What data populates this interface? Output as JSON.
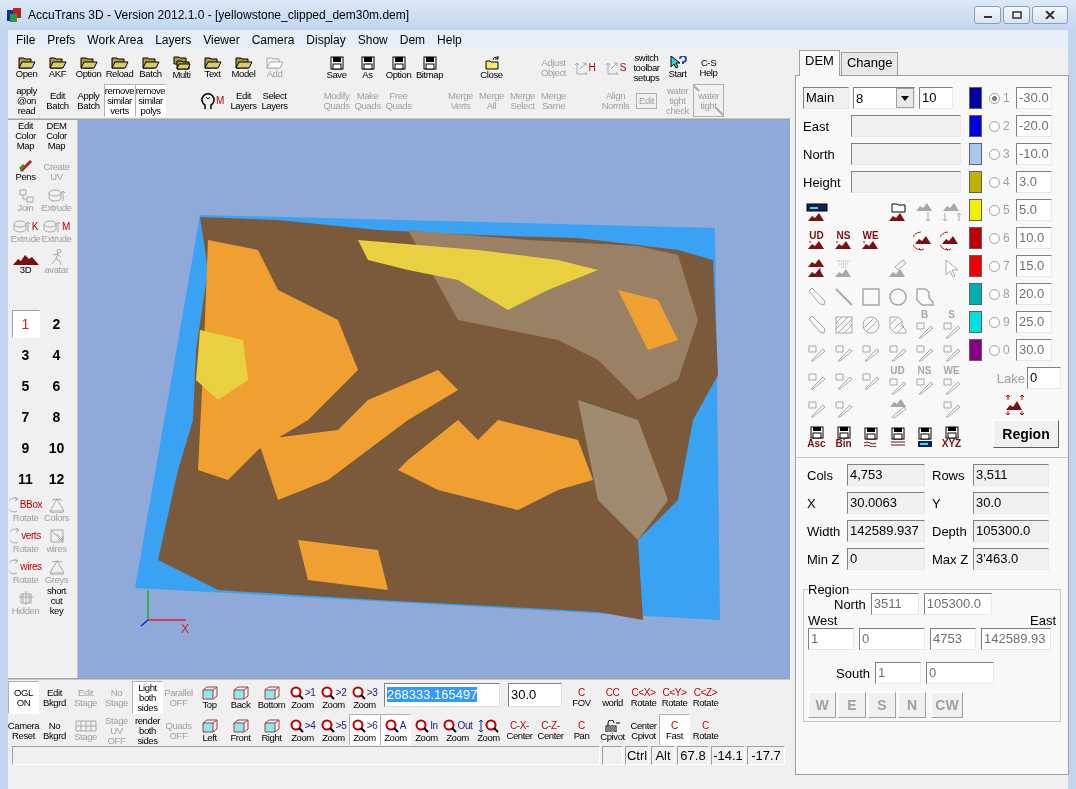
{
  "window": {
    "title": "AccuTrans 3D - Version 2012.1.0 - [yellowstone_clipped_dem30m.dem]"
  },
  "menu": [
    "File",
    "Prefs",
    "Work Area",
    "Layers",
    "Viewer",
    "Camera",
    "Display",
    "Show",
    "Dem",
    "Help"
  ],
  "top_toolbar": {
    "rows": [
      {
        "items": [
          {
            "kind": "folder",
            "lines": [
              "Open"
            ],
            "disabled": false
          },
          {
            "kind": "folder",
            "lines": [
              "AKF"
            ],
            "disabled": false
          },
          {
            "kind": "folder",
            "lines": [
              "Option"
            ],
            "disabled": false
          },
          {
            "kind": "folder",
            "lines": [
              "Reload"
            ],
            "disabled": false
          },
          {
            "kind": "folder",
            "lines": [
              "Batch"
            ],
            "disabled": false
          },
          {
            "kind": "folders",
            "lines": [
              "Multi"
            ],
            "disabled": false
          },
          {
            "kind": "folder",
            "lines": [
              "Text"
            ],
            "disabled": false
          },
          {
            "kind": "folder",
            "lines": [
              "Model"
            ],
            "disabled": false
          },
          {
            "kind": "folder",
            "lines": [
              "Add"
            ],
            "disabled": true
          },
          {
            "kind": "floppy",
            "lines": [
              "Save"
            ],
            "disabled": false
          },
          {
            "kind": "floppy",
            "lines": [
              "As"
            ],
            "disabled": false
          },
          {
            "kind": "floppy",
            "lines": [
              "Option"
            ],
            "disabled": false
          },
          {
            "kind": "floppy",
            "lines": [
              "Bitmap"
            ],
            "disabled": false
          },
          {
            "kind": "folder-up",
            "lines": [
              "Close"
            ],
            "disabled": false
          },
          {
            "kind": "text",
            "lines": [
              "Adjust",
              "Object"
            ],
            "disabled": true
          },
          {
            "kind": "axes",
            "tag": "H",
            "disabled": true
          },
          {
            "kind": "axes",
            "tag": "S",
            "disabled": true
          },
          {
            "kind": "text",
            "lines": [
              "switch",
              "toolbar",
              "setups"
            ],
            "disabled": false
          },
          {
            "kind": "pointer",
            "lines": [
              "Start"
            ],
            "disabled": false
          },
          {
            "kind": "text",
            "lines": [
              "C-S",
              "Help"
            ],
            "disabled": false
          }
        ]
      },
      {
        "items": [
          {
            "kind": "text",
            "lines": [
              "apply",
              "@on",
              "read"
            ],
            "disabled": false,
            "on": false
          },
          {
            "kind": "text",
            "lines": [
              "Edit",
              "Batch"
            ],
            "disabled": false,
            "on": false
          },
          {
            "kind": "text",
            "lines": [
              "Apply",
              "Batch"
            ],
            "disabled": false,
            "on": false
          },
          {
            "kind": "text",
            "lines": [
              "remove",
              "similar",
              "verts"
            ],
            "disabled": false,
            "on": true
          },
          {
            "kind": "text",
            "lines": [
              "remove",
              "similar",
              "polys"
            ],
            "disabled": false,
            "on": true
          },
          {
            "kind": "head",
            "tag": "M",
            "disabled": false,
            "on": false
          },
          {
            "kind": "text",
            "lines": [
              "Edit",
              "Layers"
            ],
            "disabled": false,
            "on": false
          },
          {
            "kind": "text",
            "lines": [
              "Select",
              "Layers"
            ],
            "disabled": false,
            "on": false
          },
          {
            "kind": "text",
            "lines": [
              "Modify",
              "Quads"
            ],
            "disabled": true,
            "on": false
          },
          {
            "kind": "text",
            "lines": [
              "Make",
              "Quads"
            ],
            "disabled": true,
            "on": false
          },
          {
            "kind": "text",
            "lines": [
              "Free",
              "Quads"
            ],
            "disabled": true,
            "on": false
          },
          {
            "kind": "text",
            "lines": [
              "Merge",
              "Verts"
            ],
            "disabled": true,
            "on": false
          },
          {
            "kind": "text",
            "lines": [
              "Merge",
              "All"
            ],
            "disabled": true,
            "on": false
          },
          {
            "kind": "text",
            "lines": [
              "Merge",
              "Select"
            ],
            "disabled": true,
            "on": false
          },
          {
            "kind": "text",
            "lines": [
              "Merge",
              "Same"
            ],
            "disabled": true,
            "on": false
          },
          {
            "kind": "text",
            "lines": [
              "Align",
              "Normls"
            ],
            "disabled": true,
            "on": false
          },
          {
            "kind": "frame",
            "lines": [
              "Edit"
            ],
            "disabled": true,
            "on": false
          },
          {
            "kind": "text",
            "lines": [
              "water",
              "tight",
              "check"
            ],
            "disabled": true,
            "on": false
          },
          {
            "kind": "crossed",
            "lines": [
              "water",
              "tight"
            ],
            "disabled": true,
            "on": false
          }
        ]
      }
    ]
  },
  "left_toolbar": {
    "top": [
      {
        "kind": "text",
        "lines": [
          "Edit",
          "Color",
          "Map"
        ],
        "disabled": false
      },
      {
        "kind": "pens",
        "lines": [
          "Pens"
        ],
        "disabled": false
      },
      {
        "kind": "join",
        "lines": [
          "Join"
        ],
        "disabled": true
      },
      {
        "kind": "extrude",
        "tag": "K",
        "lines": [
          "Extrude"
        ],
        "disabled": true
      },
      {
        "kind": "mountain",
        "lines": [
          "3D"
        ],
        "disabled": false
      },
      {
        "kind": "text",
        "lines": [
          "DEM",
          "Color",
          "Map"
        ],
        "disabled": false
      },
      {
        "kind": "text",
        "lines": [
          "Create",
          "UV"
        ],
        "disabled": true
      },
      {
        "kind": "extrude",
        "lines": [
          "Extrude"
        ],
        "disabled": true
      },
      {
        "kind": "extrude",
        "tag": "M",
        "lines": [
          "Extrude"
        ],
        "disabled": true
      },
      {
        "kind": "figure",
        "lines": [
          "avatar"
        ],
        "disabled": true
      }
    ],
    "numbers": [
      {
        "label": "1",
        "selected": true
      },
      {
        "label": "2",
        "selected": false
      },
      {
        "label": "3",
        "selected": false
      },
      {
        "label": "4",
        "selected": false
      },
      {
        "label": "5",
        "selected": false
      },
      {
        "label": "6",
        "selected": false
      },
      {
        "label": "7",
        "selected": false
      },
      {
        "label": "8",
        "selected": false
      },
      {
        "label": "9",
        "selected": false
      },
      {
        "label": "10",
        "selected": false
      },
      {
        "label": "11",
        "selected": false
      },
      {
        "label": "12",
        "selected": false
      }
    ],
    "bottom": [
      {
        "kind": "rotate",
        "tag": "BBox",
        "lines": [
          "Rotate"
        ],
        "disabled": true
      },
      {
        "kind": "cone",
        "lines": [
          "Colors"
        ],
        "disabled": true
      },
      {
        "kind": "rotate",
        "tag": "verts",
        "lines": [
          "Rotate"
        ],
        "disabled": true
      },
      {
        "kind": "wires",
        "lines": [
          "wires"
        ],
        "disabled": true
      },
      {
        "kind": "rotate",
        "tag": "wires",
        "lines": [
          "Rotate"
        ],
        "disabled": true
      },
      {
        "kind": "cone",
        "lines": [
          "Greys"
        ],
        "disabled": true
      },
      {
        "kind": "hidden",
        "lines": [
          "Hidden"
        ],
        "disabled": true
      },
      {
        "kind": "text",
        "lines": [
          "short",
          "cut",
          "key"
        ],
        "disabled": false
      }
    ]
  },
  "viewport": {
    "axis_label": "X"
  },
  "bottom_toolbar": {
    "rows": [
      {
        "items": [
          {
            "kind": "text",
            "lines": [
              "OGL",
              "ON"
            ],
            "disabled": false,
            "on": true
          },
          {
            "kind": "text",
            "lines": [
              "Edit",
              "Bkgrd"
            ],
            "disabled": false,
            "on": false
          },
          {
            "kind": "text",
            "lines": [
              "Edit",
              "Stage"
            ],
            "disabled": true,
            "on": false
          },
          {
            "kind": "text",
            "lines": [
              "No",
              "Stage"
            ],
            "disabled": true,
            "on": false
          },
          {
            "kind": "text",
            "lines": [
              "Light",
              "both",
              "sides"
            ],
            "disabled": false,
            "on": true
          },
          {
            "kind": "text",
            "lines": [
              "Parallel",
              "OFF"
            ],
            "disabled": true,
            "on": false
          },
          {
            "kind": "cube",
            "lines": [
              "Top"
            ],
            "disabled": false,
            "on": false
          },
          {
            "kind": "cube",
            "lines": [
              "Back"
            ],
            "disabled": false,
            "on": false
          },
          {
            "kind": "cube",
            "lines": [
              "Bottom"
            ],
            "disabled": false,
            "on": false
          },
          {
            "kind": "zoom",
            "tag": ">1",
            "lines": [
              "Zoom"
            ],
            "disabled": false,
            "on": false
          },
          {
            "kind": "zoom",
            "tag": ">2",
            "lines": [
              "Zoom"
            ],
            "disabled": false,
            "on": false
          },
          {
            "kind": "zoom",
            "tag": ">3",
            "lines": [
              "Zoom"
            ],
            "disabled": false,
            "on": false
          },
          {
            "kind": "tag",
            "tag": "C",
            "lines": [
              "FOV"
            ],
            "disabled": false,
            "on": false
          },
          {
            "kind": "tag",
            "tag": "CC",
            "lines": [
              "world"
            ],
            "disabled": false,
            "on": false
          },
          {
            "kind": "tag",
            "tag": "C<X>",
            "lines": [
              "Rotate"
            ],
            "disabled": false,
            "on": false
          },
          {
            "kind": "tag",
            "tag": "C<Y>",
            "lines": [
              "Rotate"
            ],
            "disabled": false,
            "on": false
          },
          {
            "kind": "tag",
            "tag": "C<Z>",
            "lines": [
              "Rotate"
            ],
            "disabled": false,
            "on": false
          }
        ]
      },
      {
        "items": [
          {
            "kind": "text",
            "lines": [
              "Camera",
              "Reset"
            ],
            "disabled": false,
            "on": false
          },
          {
            "kind": "text",
            "lines": [
              "No",
              "Bkgrd"
            ],
            "disabled": false,
            "on": false
          },
          {
            "kind": "grid",
            "lines": [
              "Stage"
            ],
            "disabled": true,
            "on": false
          },
          {
            "kind": "text",
            "lines": [
              "Stage",
              "UV",
              "OFF"
            ],
            "disabled": true,
            "on": false
          },
          {
            "kind": "text",
            "lines": [
              "render",
              "both",
              "sides"
            ],
            "disabled": false,
            "on": false
          },
          {
            "kind": "text",
            "lines": [
              "Quads",
              "OFF"
            ],
            "disabled": true,
            "on": false
          },
          {
            "kind": "cube",
            "lines": [
              "Left"
            ],
            "disabled": false,
            "on": false
          },
          {
            "kind": "cube",
            "lines": [
              "Front"
            ],
            "disabled": false,
            "on": false
          },
          {
            "kind": "cube",
            "lines": [
              "Right"
            ],
            "disabled": false,
            "on": false
          },
          {
            "kind": "zoom",
            "tag": ">4",
            "lines": [
              "Zoom"
            ],
            "disabled": false,
            "on": false
          },
          {
            "kind": "zoom",
            "tag": ">5",
            "lines": [
              "Zoom"
            ],
            "disabled": false,
            "on": false
          },
          {
            "kind": "zoom",
            "tag": ">6",
            "lines": [
              "Zoom"
            ],
            "disabled": false,
            "on": true
          },
          {
            "kind": "zoom",
            "tag": "A",
            "lines": [
              "Zoom"
            ],
            "disabled": false,
            "on": true
          },
          {
            "kind": "zoom",
            "tag": "In",
            "lines": [
              "Zoom"
            ],
            "disabled": false,
            "on": false
          },
          {
            "kind": "zoom",
            "tag": "Out",
            "lines": [
              "Zoom"
            ],
            "disabled": false,
            "on": false
          },
          {
            "kind": "zoom-updown",
            "lines": [
              "Zoom"
            ],
            "disabled": false,
            "on": false
          },
          {
            "kind": "tag",
            "tag": "C-X-",
            "lines": [
              "Center"
            ],
            "disabled": false,
            "on": false
          },
          {
            "kind": "tag",
            "tag": "C-Z-",
            "lines": [
              "Center"
            ],
            "disabled": false,
            "on": false
          },
          {
            "kind": "tag",
            "tag": "C",
            "lines": [
              "Pan"
            ],
            "disabled": false,
            "on": false
          },
          {
            "kind": "lock",
            "lines": [
              "Cpivot"
            ],
            "disabled": false,
            "on": false
          },
          {
            "kind": "text",
            "lines": [
              "Center",
              "Cpivot"
            ],
            "disabled": false,
            "on": false
          },
          {
            "kind": "tag",
            "tag": "C",
            "lines": [
              "Fast"
            ],
            "disabled": false,
            "on": true
          },
          {
            "kind": "tag",
            "tag": "C",
            "lines": [
              "Rotate"
            ],
            "disabled": false,
            "on": false
          }
        ]
      }
    ],
    "fields": [
      {
        "value": "268333.165497",
        "text_selected": true
      },
      {
        "value": "30.0",
        "text_selected": false
      }
    ]
  },
  "status_bar": {
    "cells": [
      "Ctrl",
      "Alt",
      "67.8",
      "-14.1",
      "-17.7"
    ]
  },
  "dem_panel": {
    "tabs": [
      {
        "label": "DEM",
        "selected": true
      },
      {
        "label": "Change",
        "selected": false
      }
    ],
    "main": {
      "label": "Main",
      "dropdown": "8",
      "value": "10"
    },
    "fields": [
      {
        "label": "East"
      },
      {
        "label": "North"
      },
      {
        "label": "Height"
      }
    ],
    "tools": [
      [
        {
          "kind": "map-terrain",
          "disabled": false
        },
        {
          "kind": "folder-terrain",
          "disabled": false
        },
        {
          "kind": "terrain-down",
          "disabled": true
        },
        {
          "kind": "terrain-arrows",
          "disabled": true
        }
      ],
      [
        {
          "kind": "terrain",
          "tag": "UD",
          "disabled": false
        },
        {
          "kind": "terrain",
          "tag": "NS",
          "disabled": false
        },
        {
          "kind": "terrain",
          "tag": "WE",
          "disabled": false
        },
        {
          "kind": "terrain-rotate",
          "disabled": false
        },
        {
          "kind": "terrain-rotate",
          "disabled": false
        }
      ],
      [
        {
          "kind": "terrain-down",
          "disabled": false
        },
        {
          "kind": "cloud",
          "disabled": true
        },
        {
          "kind": "pen-terrain",
          "disabled": true
        },
        {
          "kind": "pointer",
          "disabled": true
        }
      ],
      [
        {
          "kind": "pencil",
          "disabled": true
        },
        {
          "kind": "line",
          "disabled": true
        },
        {
          "kind": "square",
          "disabled": true
        },
        {
          "kind": "circle",
          "disabled": true
        },
        {
          "kind": "blob",
          "disabled": true
        }
      ],
      [
        {
          "kind": "pencil",
          "disabled": true
        },
        {
          "kind": "hatched-square",
          "disabled": true
        },
        {
          "kind": "hatched-circle",
          "disabled": true
        },
        {
          "kind": "hatched-blob",
          "disabled": true
        },
        {
          "kind": "knife",
          "tag": "B",
          "disabled": true
        },
        {
          "kind": "knife",
          "tag": "S",
          "disabled": true
        }
      ],
      [
        {
          "kind": "knife",
          "disabled": true
        },
        {
          "kind": "knife",
          "disabled": true
        },
        {
          "kind": "knife",
          "disabled": true
        },
        {
          "kind": "knife",
          "disabled": true
        },
        {
          "kind": "knife",
          "disabled": true
        },
        {
          "kind": "knife",
          "disabled": true
        }
      ],
      [
        {
          "kind": "knife",
          "disabled": true
        },
        {
          "kind": "knife",
          "disabled": true
        },
        {
          "kind": "knife",
          "disabled": true
        },
        {
          "kind": "knife",
          "tag": "UD",
          "disabled": true
        },
        {
          "kind": "knife",
          "tag": "NS",
          "disabled": true
        },
        {
          "kind": "knife",
          "tag": "WE",
          "disabled": true
        }
      ],
      [
        {
          "kind": "knife",
          "disabled": true
        },
        {
          "kind": "knife",
          "disabled": true
        },
        {
          "kind": "terrain-knife",
          "disabled": true
        },
        {
          "kind": "knife",
          "disabled": true
        }
      ],
      [
        {
          "kind": "floppy",
          "tag": "Asc",
          "disabled": false
        },
        {
          "kind": "floppy",
          "tag": "Bin",
          "disabled": false
        },
        {
          "kind": "floppy-wave",
          "disabled": false
        },
        {
          "kind": "floppy-lines",
          "disabled": false
        },
        {
          "kind": "floppy-map",
          "disabled": false
        },
        {
          "kind": "floppy",
          "tag": "XYZ",
          "disabled": false
        }
      ]
    ],
    "color_levels": [
      {
        "key": "1",
        "color": "#0000a8",
        "value": "-30.0",
        "selected": true
      },
      {
        "key": "2",
        "color": "#0000e0",
        "value": "-20.0",
        "selected": false
      },
      {
        "key": "3",
        "color": "#a8c8f0",
        "value": "-10.0",
        "selected": false
      },
      {
        "key": "4",
        "color": "#c0b000",
        "value": "3.0",
        "selected": false
      },
      {
        "key": "5",
        "color": "#f0f000",
        "value": "5.0",
        "selected": false
      },
      {
        "key": "6",
        "color": "#c00000",
        "value": "10.0",
        "selected": false
      },
      {
        "key": "7",
        "color": "#f00000",
        "value": "15.0",
        "selected": false
      },
      {
        "key": "8",
        "color": "#00b0b0",
        "value": "20.0",
        "selected": false
      },
      {
        "key": "9",
        "color": "#00e0e0",
        "value": "25.0",
        "selected": false
      },
      {
        "key": "0",
        "color": "#880088",
        "value": "30.0",
        "selected": false
      }
    ],
    "lake": {
      "label": "Lake",
      "value": "0"
    },
    "region_button": "Region",
    "info": [
      {
        "label": "Cols",
        "value": "4,753"
      },
      {
        "label": "Rows",
        "value": "3,511"
      },
      {
        "label": "X",
        "value": "30.0063"
      },
      {
        "label": "Y",
        "value": "30.0"
      },
      {
        "label": "Width",
        "value": "142589.937"
      },
      {
        "label": "Depth",
        "value": "105300.0"
      },
      {
        "label": "Min Z",
        "value": "0"
      },
      {
        "label": "Max  Z",
        "value": "3'463.0"
      }
    ],
    "region": {
      "title": "Region",
      "north_label": "North",
      "north_values": [
        "3511",
        "105300.0"
      ],
      "west_label": "West",
      "east_label": "East",
      "middle_values": [
        "1",
        "0",
        "4753",
        "142589.93"
      ],
      "south_label": "South",
      "south_values": [
        "1",
        "0"
      ],
      "buttons": [
        "W",
        "E",
        "S",
        "N",
        "CW"
      ]
    }
  }
}
